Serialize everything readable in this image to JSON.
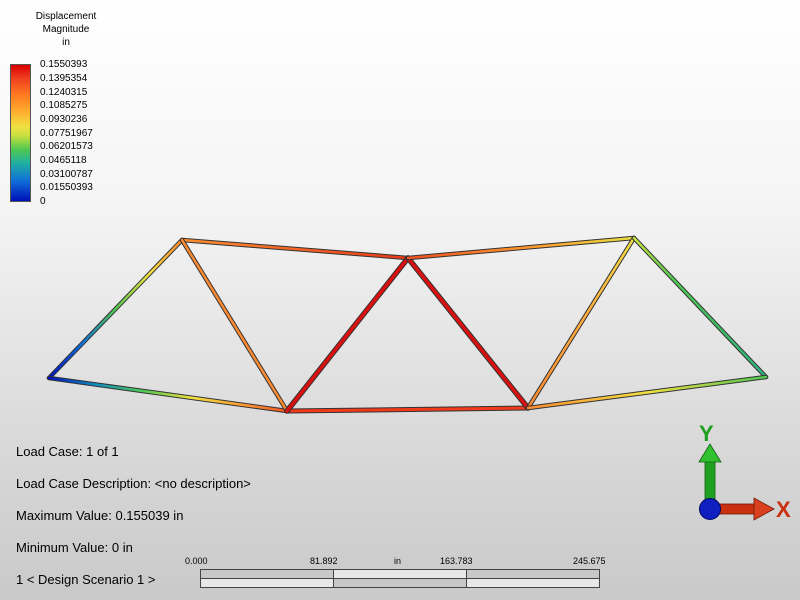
{
  "legend": {
    "title_lines": [
      "Displacement",
      "Magnitude",
      "in"
    ],
    "labels": [
      "0.1550393",
      "0.1395354",
      "0.1240315",
      "0.1085275",
      "0.0930236",
      "0.07751967",
      "0.06201573",
      "0.0465118",
      "0.03100787",
      "0.01550393",
      "0"
    ]
  },
  "info": {
    "load_case_label": "Load Case:",
    "load_case_value": "1 of 1",
    "description_label": "Load Case Description:",
    "description_value": "<no description>",
    "max_label": "Maximum Value:",
    "max_value": "0.155039 in",
    "min_label": "Minimum Value:",
    "min_value": "0 in",
    "scenario": "1 < Design Scenario 1 >"
  },
  "scalebar": {
    "unit": "in",
    "ticks": [
      "0.000",
      "81.892",
      "163.783",
      "245.675"
    ]
  },
  "triad": {
    "y_label": "Y",
    "x_label": "X"
  },
  "colors": {
    "max": "#d80000",
    "high": "#ff7a20",
    "mid": "#f0e040",
    "low": "#50c850",
    "min": "#0010b8",
    "axis_y": "#20a020",
    "axis_x": "#c83010",
    "axis_z": "#1020c0"
  }
}
